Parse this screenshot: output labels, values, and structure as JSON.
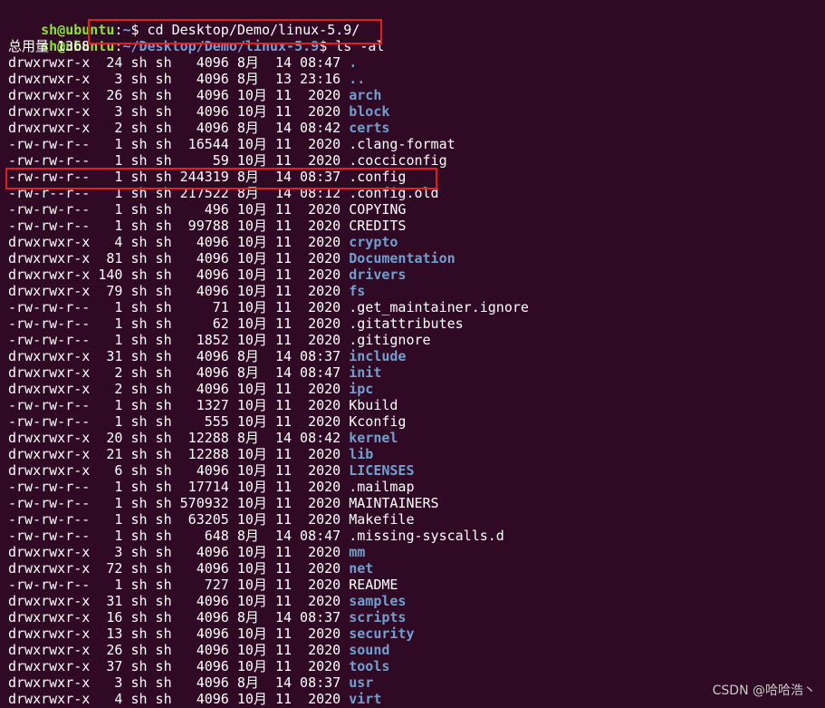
{
  "prompt_lines": [
    {
      "user": "sh@ubuntu",
      "sep": ":",
      "path": "~",
      "suffix": "$ cd Desktop/Demo/linux-5.9/"
    },
    {
      "user": "sh@ubuntu",
      "sep": ":",
      "path": "~/Desktop/Demo/linux-5.9",
      "suffix": "$ ls -al"
    }
  ],
  "total": "总用量 1368",
  "listing": [
    {
      "perm": "drwxrwxr-x",
      "links": "24",
      "user": "sh",
      "group": "sh",
      "size": "4096",
      "month": "8月",
      "day": "14",
      "time": "08:47",
      "name": ".",
      "is_dir": true
    },
    {
      "perm": "drwxrwxr-x",
      "links": "3",
      "user": "sh",
      "group": "sh",
      "size": "4096",
      "month": "8月",
      "day": "13",
      "time": "23:16",
      "name": "..",
      "is_dir": true
    },
    {
      "perm": "drwxrwxr-x",
      "links": "26",
      "user": "sh",
      "group": "sh",
      "size": "4096",
      "month": "10月",
      "day": "11",
      "time": "2020",
      "name": "arch",
      "is_dir": true
    },
    {
      "perm": "drwxrwxr-x",
      "links": "3",
      "user": "sh",
      "group": "sh",
      "size": "4096",
      "month": "10月",
      "day": "11",
      "time": "2020",
      "name": "block",
      "is_dir": true
    },
    {
      "perm": "drwxrwxr-x",
      "links": "2",
      "user": "sh",
      "group": "sh",
      "size": "4096",
      "month": "8月",
      "day": "14",
      "time": "08:42",
      "name": "certs",
      "is_dir": true
    },
    {
      "perm": "-rw-rw-r--",
      "links": "1",
      "user": "sh",
      "group": "sh",
      "size": "16544",
      "month": "10月",
      "day": "11",
      "time": "2020",
      "name": ".clang-format",
      "is_dir": false
    },
    {
      "perm": "-rw-rw-r--",
      "links": "1",
      "user": "sh",
      "group": "sh",
      "size": "59",
      "month": "10月",
      "day": "11",
      "time": "2020",
      "name": ".cocciconfig",
      "is_dir": false
    },
    {
      "perm": "-rw-rw-r--",
      "links": "1",
      "user": "sh",
      "group": "sh",
      "size": "244319",
      "month": "8月",
      "day": "14",
      "time": "08:37",
      "name": ".config",
      "is_dir": false
    },
    {
      "perm": "-rw-r--r--",
      "links": "1",
      "user": "sh",
      "group": "sh",
      "size": "217522",
      "month": "8月",
      "day": "14",
      "time": "08:12",
      "name": ".config.old",
      "is_dir": false
    },
    {
      "perm": "-rw-rw-r--",
      "links": "1",
      "user": "sh",
      "group": "sh",
      "size": "496",
      "month": "10月",
      "day": "11",
      "time": "2020",
      "name": "COPYING",
      "is_dir": false
    },
    {
      "perm": "-rw-rw-r--",
      "links": "1",
      "user": "sh",
      "group": "sh",
      "size": "99788",
      "month": "10月",
      "day": "11",
      "time": "2020",
      "name": "CREDITS",
      "is_dir": false
    },
    {
      "perm": "drwxrwxr-x",
      "links": "4",
      "user": "sh",
      "group": "sh",
      "size": "4096",
      "month": "10月",
      "day": "11",
      "time": "2020",
      "name": "crypto",
      "is_dir": true
    },
    {
      "perm": "drwxrwxr-x",
      "links": "81",
      "user": "sh",
      "group": "sh",
      "size": "4096",
      "month": "10月",
      "day": "11",
      "time": "2020",
      "name": "Documentation",
      "is_dir": true
    },
    {
      "perm": "drwxrwxr-x",
      "links": "140",
      "user": "sh",
      "group": "sh",
      "size": "4096",
      "month": "10月",
      "day": "11",
      "time": "2020",
      "name": "drivers",
      "is_dir": true
    },
    {
      "perm": "drwxrwxr-x",
      "links": "79",
      "user": "sh",
      "group": "sh",
      "size": "4096",
      "month": "10月",
      "day": "11",
      "time": "2020",
      "name": "fs",
      "is_dir": true
    },
    {
      "perm": "-rw-rw-r--",
      "links": "1",
      "user": "sh",
      "group": "sh",
      "size": "71",
      "month": "10月",
      "day": "11",
      "time": "2020",
      "name": ".get_maintainer.ignore",
      "is_dir": false
    },
    {
      "perm": "-rw-rw-r--",
      "links": "1",
      "user": "sh",
      "group": "sh",
      "size": "62",
      "month": "10月",
      "day": "11",
      "time": "2020",
      "name": ".gitattributes",
      "is_dir": false
    },
    {
      "perm": "-rw-rw-r--",
      "links": "1",
      "user": "sh",
      "group": "sh",
      "size": "1852",
      "month": "10月",
      "day": "11",
      "time": "2020",
      "name": ".gitignore",
      "is_dir": false
    },
    {
      "perm": "drwxrwxr-x",
      "links": "31",
      "user": "sh",
      "group": "sh",
      "size": "4096",
      "month": "8月",
      "day": "14",
      "time": "08:37",
      "name": "include",
      "is_dir": true
    },
    {
      "perm": "drwxrwxr-x",
      "links": "2",
      "user": "sh",
      "group": "sh",
      "size": "4096",
      "month": "8月",
      "day": "14",
      "time": "08:47",
      "name": "init",
      "is_dir": true
    },
    {
      "perm": "drwxrwxr-x",
      "links": "2",
      "user": "sh",
      "group": "sh",
      "size": "4096",
      "month": "10月",
      "day": "11",
      "time": "2020",
      "name": "ipc",
      "is_dir": true
    },
    {
      "perm": "-rw-rw-r--",
      "links": "1",
      "user": "sh",
      "group": "sh",
      "size": "1327",
      "month": "10月",
      "day": "11",
      "time": "2020",
      "name": "Kbuild",
      "is_dir": false
    },
    {
      "perm": "-rw-rw-r--",
      "links": "1",
      "user": "sh",
      "group": "sh",
      "size": "555",
      "month": "10月",
      "day": "11",
      "time": "2020",
      "name": "Kconfig",
      "is_dir": false
    },
    {
      "perm": "drwxrwxr-x",
      "links": "20",
      "user": "sh",
      "group": "sh",
      "size": "12288",
      "month": "8月",
      "day": "14",
      "time": "08:42",
      "name": "kernel",
      "is_dir": true
    },
    {
      "perm": "drwxrwxr-x",
      "links": "21",
      "user": "sh",
      "group": "sh",
      "size": "12288",
      "month": "10月",
      "day": "11",
      "time": "2020",
      "name": "lib",
      "is_dir": true
    },
    {
      "perm": "drwxrwxr-x",
      "links": "6",
      "user": "sh",
      "group": "sh",
      "size": "4096",
      "month": "10月",
      "day": "11",
      "time": "2020",
      "name": "LICENSES",
      "is_dir": true
    },
    {
      "perm": "-rw-rw-r--",
      "links": "1",
      "user": "sh",
      "group": "sh",
      "size": "17714",
      "month": "10月",
      "day": "11",
      "time": "2020",
      "name": ".mailmap",
      "is_dir": false
    },
    {
      "perm": "-rw-rw-r--",
      "links": "1",
      "user": "sh",
      "group": "sh",
      "size": "570932",
      "month": "10月",
      "day": "11",
      "time": "2020",
      "name": "MAINTAINERS",
      "is_dir": false
    },
    {
      "perm": "-rw-rw-r--",
      "links": "1",
      "user": "sh",
      "group": "sh",
      "size": "63205",
      "month": "10月",
      "day": "11",
      "time": "2020",
      "name": "Makefile",
      "is_dir": false
    },
    {
      "perm": "-rw-rw-r--",
      "links": "1",
      "user": "sh",
      "group": "sh",
      "size": "648",
      "month": "8月",
      "day": "14",
      "time": "08:47",
      "name": ".missing-syscalls.d",
      "is_dir": false
    },
    {
      "perm": "drwxrwxr-x",
      "links": "3",
      "user": "sh",
      "group": "sh",
      "size": "4096",
      "month": "10月",
      "day": "11",
      "time": "2020",
      "name": "mm",
      "is_dir": true
    },
    {
      "perm": "drwxrwxr-x",
      "links": "72",
      "user": "sh",
      "group": "sh",
      "size": "4096",
      "month": "10月",
      "day": "11",
      "time": "2020",
      "name": "net",
      "is_dir": true
    },
    {
      "perm": "-rw-rw-r--",
      "links": "1",
      "user": "sh",
      "group": "sh",
      "size": "727",
      "month": "10月",
      "day": "11",
      "time": "2020",
      "name": "README",
      "is_dir": false
    },
    {
      "perm": "drwxrwxr-x",
      "links": "31",
      "user": "sh",
      "group": "sh",
      "size": "4096",
      "month": "10月",
      "day": "11",
      "time": "2020",
      "name": "samples",
      "is_dir": true
    },
    {
      "perm": "drwxrwxr-x",
      "links": "16",
      "user": "sh",
      "group": "sh",
      "size": "4096",
      "month": "8月",
      "day": "14",
      "time": "08:37",
      "name": "scripts",
      "is_dir": true
    },
    {
      "perm": "drwxrwxr-x",
      "links": "13",
      "user": "sh",
      "group": "sh",
      "size": "4096",
      "month": "10月",
      "day": "11",
      "time": "2020",
      "name": "security",
      "is_dir": true
    },
    {
      "perm": "drwxrwxr-x",
      "links": "26",
      "user": "sh",
      "group": "sh",
      "size": "4096",
      "month": "10月",
      "day": "11",
      "time": "2020",
      "name": "sound",
      "is_dir": true
    },
    {
      "perm": "drwxrwxr-x",
      "links": "37",
      "user": "sh",
      "group": "sh",
      "size": "4096",
      "month": "10月",
      "day": "11",
      "time": "2020",
      "name": "tools",
      "is_dir": true
    },
    {
      "perm": "drwxrwxr-x",
      "links": "3",
      "user": "sh",
      "group": "sh",
      "size": "4096",
      "month": "8月",
      "day": "14",
      "time": "08:37",
      "name": "usr",
      "is_dir": true
    },
    {
      "perm": "drwxrwxr-x",
      "links": "4",
      "user": "sh",
      "group": "sh",
      "size": "4096",
      "month": "10月",
      "day": "11",
      "time": "2020",
      "name": "virt",
      "is_dir": true
    }
  ],
  "watermark": "CSDN @哈哈浩丶",
  "colors": {
    "background": "#300a24",
    "user": "#8ae234",
    "directory": "#729fcf",
    "text": "#ffffff",
    "highlight": "#e02020"
  }
}
